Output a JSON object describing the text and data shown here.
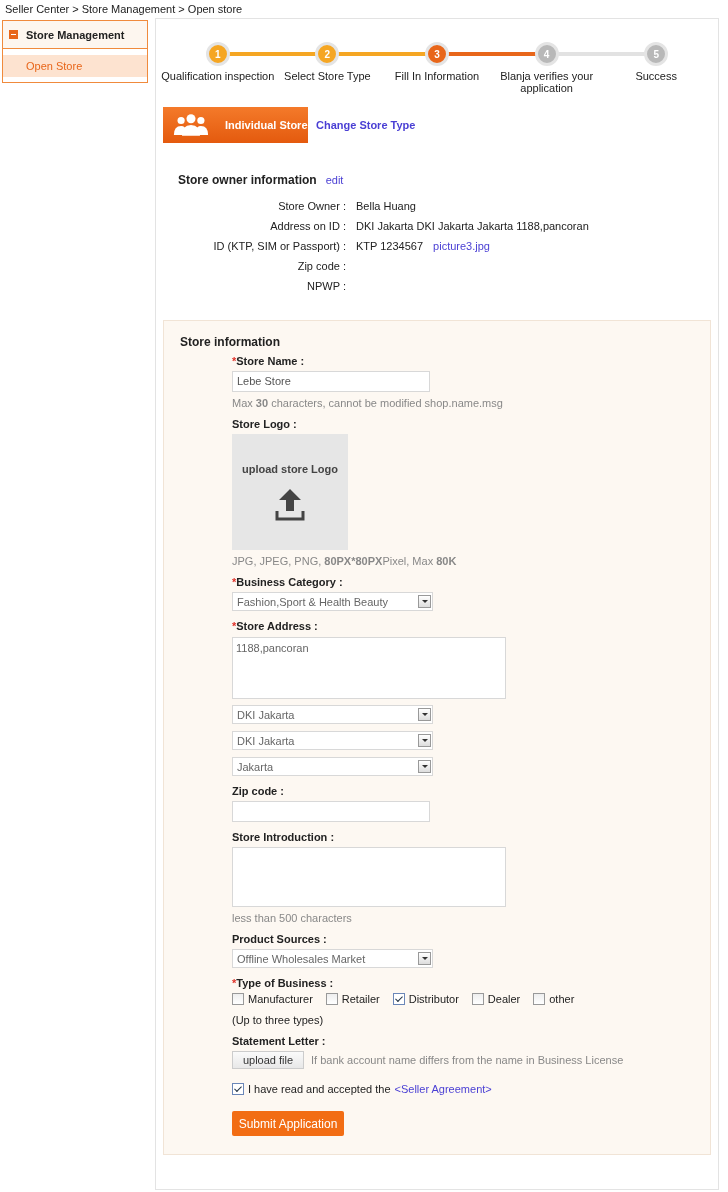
{
  "breadcrumb": "Seller Center > Store Management > Open store",
  "sidebar": {
    "group": {
      "label": "Store Management",
      "expanded": true
    },
    "items": [
      {
        "label": "Open Store",
        "selected": true
      }
    ]
  },
  "steps": [
    {
      "number": "1",
      "label": "Qualification inspection",
      "current": false
    },
    {
      "number": "2",
      "label": "Select Store Type",
      "current": false
    },
    {
      "number": "3",
      "label": "Fill In Information",
      "current": true
    },
    {
      "number": "4",
      "label": "Blanja verifies your application",
      "current": false
    },
    {
      "number": "5",
      "label": "Success",
      "current": false
    }
  ],
  "store_type": {
    "label": "Individual Store",
    "change_link": "Change Store Type"
  },
  "owner_info": {
    "title": "Store owner information",
    "edit_link": "edit",
    "rows": [
      {
        "label": "Store Owner :",
        "value": "Bella Huang"
      },
      {
        "label": "Address on ID :",
        "value": "DKI Jakarta  DKI Jakarta  Jakarta  1188,pancoran"
      },
      {
        "label": "ID (KTP, SIM or Passport) :",
        "value": "KTP   1234567",
        "link": "picture3.jpg"
      },
      {
        "label": "Zip code :"
      },
      {
        "label": "NPWP :"
      }
    ]
  },
  "store_info": {
    "title": "Store information",
    "fields": [
      {
        "kind": "input",
        "label": "Store Name :",
        "required_mark": "*",
        "value": "Lebe Store",
        "hint": "Max **30** characters, cannot be modified shop.name.msg"
      },
      {
        "kind": "logo",
        "label": "Store Logo :",
        "upload_text": "upload store Logo",
        "hint": "JPG, JPEG, PNG, **80PX*80PX**Pixel, Max **80K**"
      },
      {
        "kind": "select",
        "label": "Business Category :",
        "required_mark": "*",
        "value": "Fashion,Sport & Health Beauty"
      },
      {
        "kind": "address",
        "label": "Store Address :",
        "required_mark": "*",
        "value": "1188,pancoran",
        "selects": [
          "DKI Jakarta",
          "DKI Jakarta",
          "Jakarta"
        ]
      },
      {
        "kind": "input",
        "label": "Zip code :"
      },
      {
        "kind": "textarea",
        "label": "Store Introduction :",
        "hint": "less than 500 characters"
      },
      {
        "kind": "select",
        "label": "Product Sources :",
        "value": "Offline Wholesales Market"
      },
      {
        "kind": "checkboxes",
        "label": "Type of Business :",
        "required_mark": "*",
        "note": "(Up to three types)",
        "options": [
          {
            "label": "Manufacturer",
            "checked": false
          },
          {
            "label": "Retailer",
            "checked": false
          },
          {
            "label": "Distributor",
            "checked": true
          },
          {
            "label": "Dealer",
            "checked": false
          },
          {
            "label": "other",
            "checked": false
          }
        ]
      },
      {
        "kind": "file",
        "label": "Statement Letter :",
        "button": "upload file",
        "hint": "If bank account name differs from the name in Business License"
      }
    ],
    "agreement": {
      "checked": true,
      "text": "I have read and accepted the",
      "link": "<Seller Agreement>"
    },
    "submit": "Submit Application"
  }
}
